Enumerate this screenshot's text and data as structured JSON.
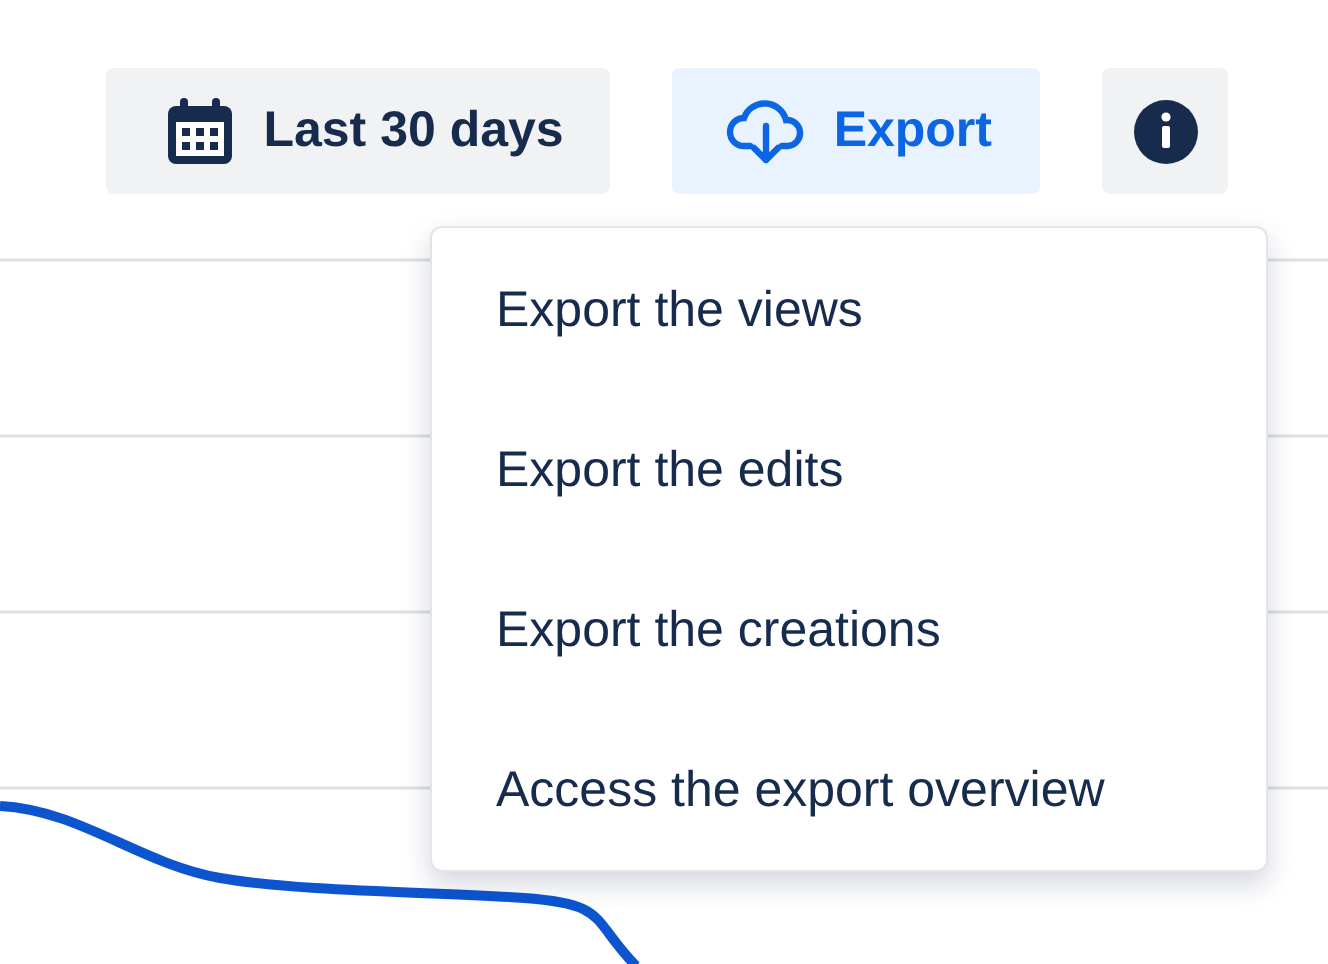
{
  "toolbar": {
    "date_range": "Last 30 days",
    "export": "Export"
  },
  "export_menu": {
    "items": [
      "Export the views",
      "Export the edits",
      "Export the creations",
      "Access the export overview"
    ]
  }
}
